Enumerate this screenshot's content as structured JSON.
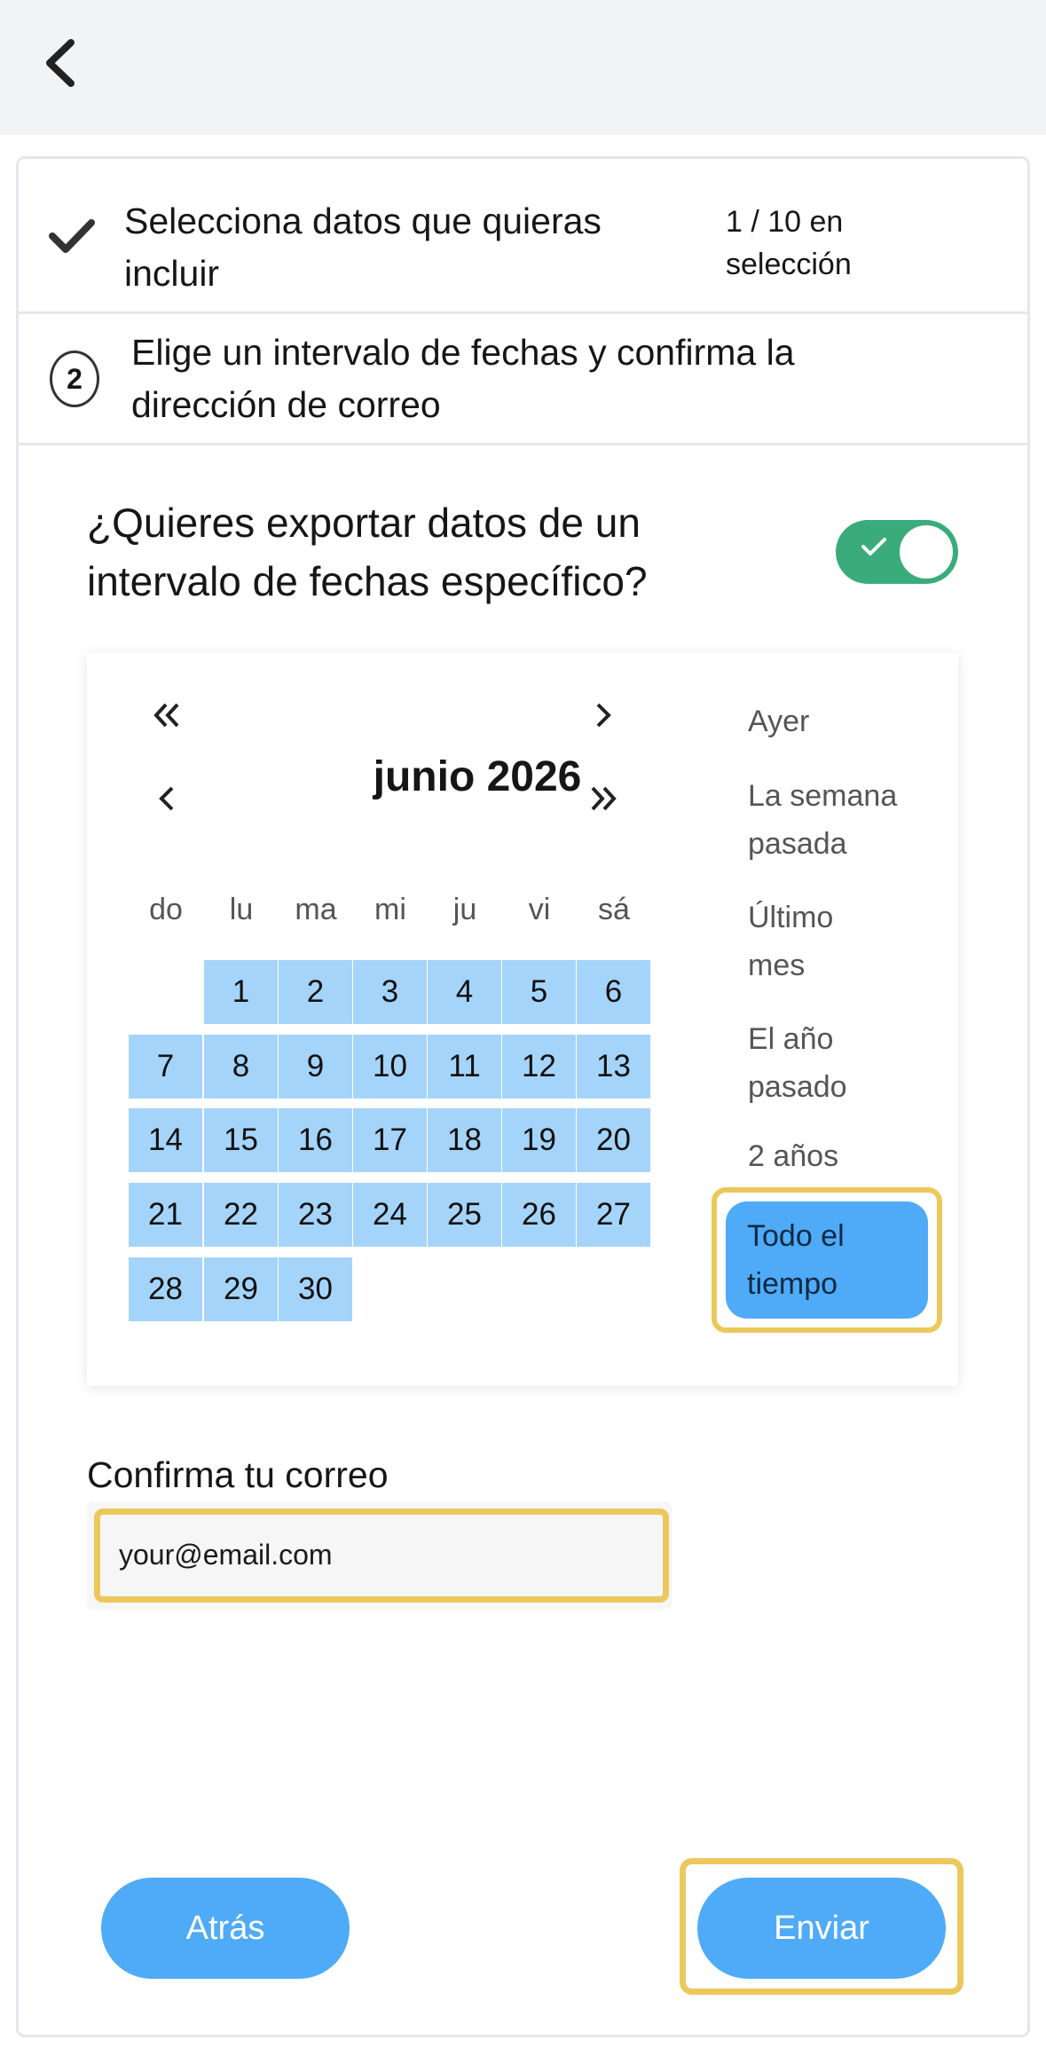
{
  "header": {
    "back_icon": "chevron-left-icon"
  },
  "steps": {
    "step1": {
      "title": "Selecciona datos que quieras incluir",
      "count": "1 / 10 en selección",
      "icon": "check-icon"
    },
    "step2": {
      "number": "2",
      "title": "Elige un intervalo de fechas y confirma la dirección de correo"
    }
  },
  "date_range": {
    "question": "¿Quieres exportar datos de un intervalo de fechas específico?",
    "toggle_on": true,
    "toggle_color": "#3aac7c"
  },
  "calendar": {
    "month_label": "junio 2026",
    "nav": {
      "prev_year_icon": "double-chevron-left-icon",
      "prev_month_icon": "chevron-left-icon",
      "next_month_icon": "chevron-right-icon",
      "next_year_icon": "double-chevron-right-icon"
    },
    "weekdays": [
      "do",
      "lu",
      "ma",
      "mi",
      "ju",
      "vi",
      "sá"
    ],
    "first_weekday_index": 1,
    "days": [
      "1",
      "2",
      "3",
      "4",
      "5",
      "6",
      "7",
      "8",
      "9",
      "10",
      "11",
      "12",
      "13",
      "14",
      "15",
      "16",
      "17",
      "18",
      "19",
      "20",
      "21",
      "22",
      "23",
      "24",
      "25",
      "26",
      "27",
      "28",
      "29",
      "30"
    ],
    "selected_color": "#a5d4fa"
  },
  "presets": {
    "items": [
      "Ayer",
      "La semana pasada",
      "Último mes",
      "El año pasado",
      "2 años"
    ],
    "active": "Todo el tiempo",
    "active_color": "#4fabf7"
  },
  "email": {
    "label": "Confirma tu correo",
    "value": "your@email.com"
  },
  "actions": {
    "back_label": "Atrás",
    "send_label": "Enviar",
    "button_color": "#4fabf7",
    "highlight_color": "#ecc85c"
  }
}
